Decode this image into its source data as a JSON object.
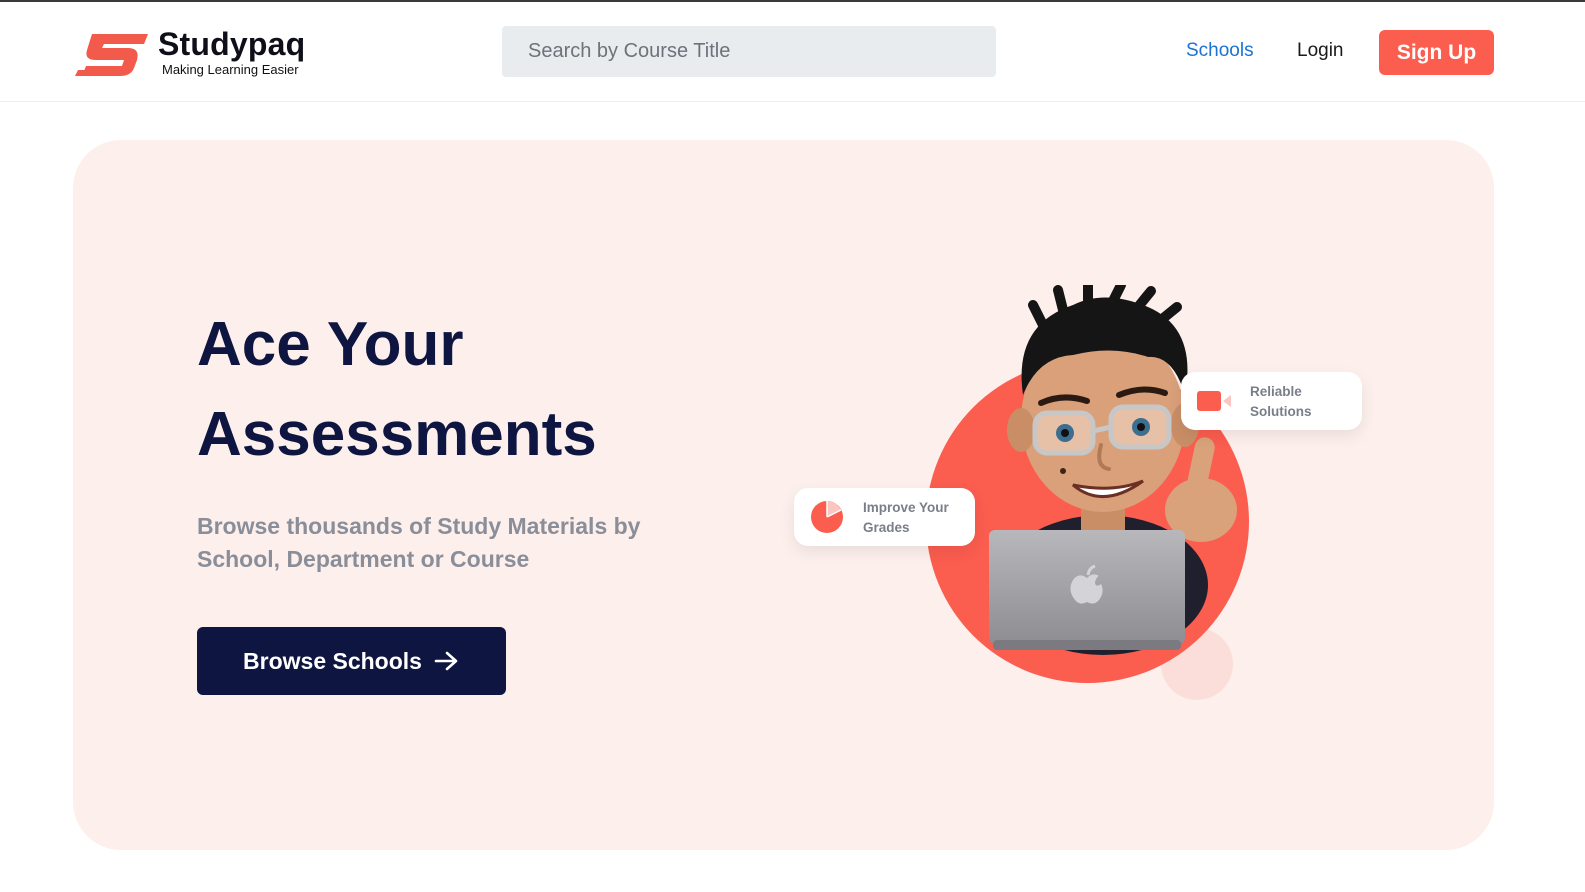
{
  "header": {
    "brand_name": "Studypaq",
    "brand_tagline": "Making Learning Easier",
    "search_placeholder": "Search by Course Title",
    "nav": {
      "schools": "Schools",
      "login": "Login",
      "signup": "Sign Up"
    }
  },
  "hero": {
    "title_line1": "Ace Your",
    "title_line2": "Assessments",
    "subtitle": "Browse thousands of Study Materials by School, Department or Course",
    "cta_label": "Browse Schools",
    "cards": {
      "reliable": "Reliable Solutions",
      "grades": "Improve Your Grades"
    }
  },
  "colors": {
    "accent": "#fb5d4f",
    "navy": "#0d1540",
    "hero_bg": "#fdefec",
    "link_blue": "#1b73d6"
  },
  "icons": [
    "brand-logo-icon",
    "arrow-right-icon",
    "video-camera-icon",
    "pie-chart-icon",
    "apple-logo-icon"
  ]
}
